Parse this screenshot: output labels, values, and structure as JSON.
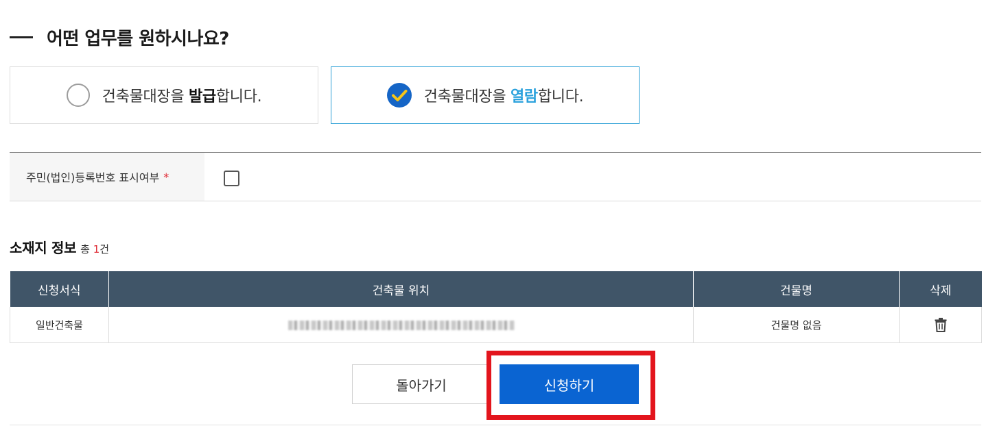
{
  "heading": {
    "title": "어떤 업무를 원하시나요?"
  },
  "options": [
    {
      "prefix": "건축물대장을 ",
      "strong": "발급",
      "suffix": "합니다.",
      "selected": false
    },
    {
      "prefix": "건축물대장을 ",
      "strong": "열람",
      "suffix": "합니다.",
      "selected": true
    }
  ],
  "form": {
    "label": "주민(법인)등록번호 표시여부",
    "required_mark": "*",
    "checked": false
  },
  "section": {
    "title": "소재지 정보",
    "total_prefix": "총 ",
    "total_count": "1",
    "total_suffix": "건"
  },
  "table": {
    "headers": [
      "신청서식",
      "건축물 위치",
      "건물명",
      "삭제"
    ],
    "rows": [
      {
        "form_type": "일반건축물",
        "location": "",
        "building_name": "건물명 없음"
      }
    ]
  },
  "buttons": {
    "back": "돌아가기",
    "apply": "신청하기"
  },
  "colors": {
    "accent": "#0a64d2",
    "table_header": "#405568",
    "highlight": "#e3151d",
    "selected_border": "#2a9fd6"
  },
  "icons": {
    "check": "check-circle-icon",
    "delete": "trash-icon"
  }
}
